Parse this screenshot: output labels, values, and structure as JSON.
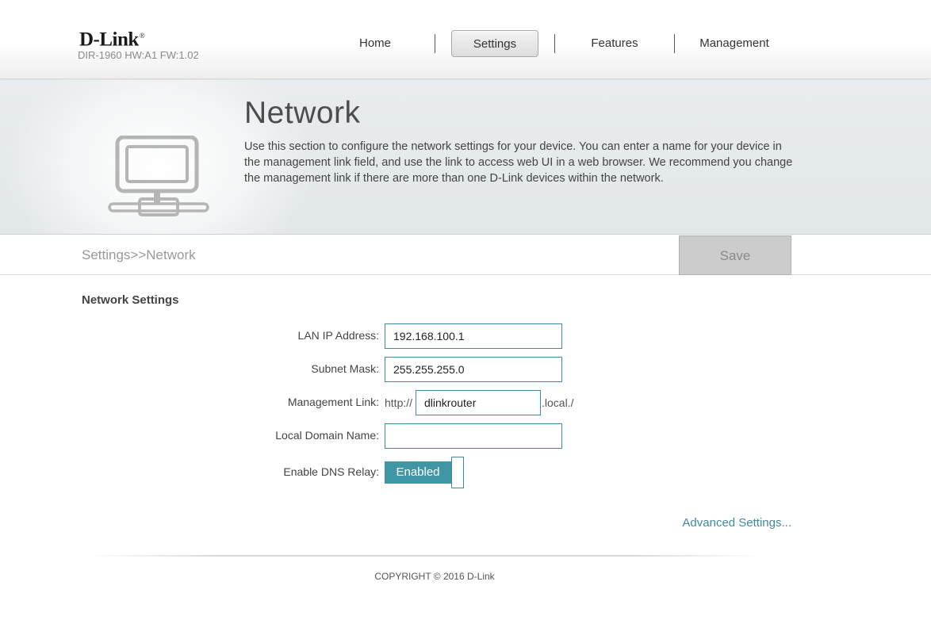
{
  "header": {
    "logo": "D-Link",
    "logo_reg": "®",
    "firmware": "DIR-1960 HW:A1 FW:1.02",
    "nav": [
      {
        "label": "Home"
      },
      {
        "label": "Settings",
        "active": true
      },
      {
        "label": "Features"
      },
      {
        "label": "Management"
      }
    ]
  },
  "banner": {
    "icon": "network-computer-icon",
    "title": "Network",
    "description": "Use this section to configure the network settings for your device. You can enter a name for your device in the management link field, and use the link to access web UI in a web browser. We recommend you change the management link if there are more than one D-Link devices within the network."
  },
  "breadcrumb": "Settings>>Network",
  "toolbar": {
    "save_label": "Save"
  },
  "form": {
    "section_title": "Network Settings",
    "lan_ip": {
      "label": "LAN IP Address:",
      "value": "192.168.100.1"
    },
    "subnet": {
      "label": "Subnet Mask:",
      "value": "255.255.255.0"
    },
    "mgmt": {
      "label": "Management Link:",
      "prefix": "http://",
      "value": "dlinkrouter",
      "suffix": ".local./"
    },
    "domain": {
      "label": "Local Domain Name:",
      "value": ""
    },
    "dns_relay": {
      "label": "Enable DNS Relay:",
      "state": "Enabled"
    }
  },
  "advanced_link": "Advanced Settings...",
  "footer": {
    "copyright": "COPYRIGHT © 2016 D-Link"
  },
  "colors": {
    "accent": "#3f97a6",
    "border": "#3f8b99"
  }
}
